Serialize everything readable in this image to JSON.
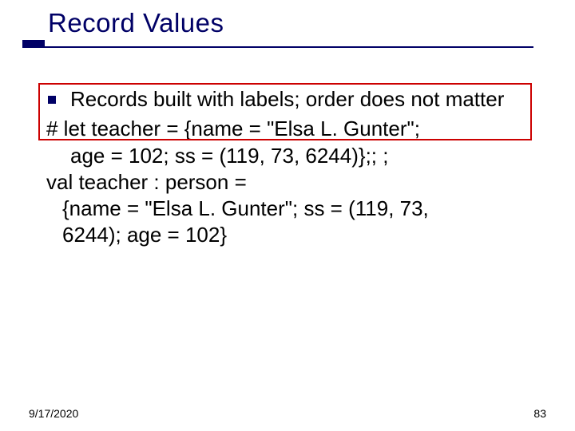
{
  "title": "Record Values",
  "bullet": "Records built with labels; order does not matter",
  "code": {
    "l1a": "# let teacher = {name = \"Elsa L. Gunter\";",
    "l1b": "age = 102; ss = (119, 73, 6244)};; ;",
    "l2a": "val teacher : person =",
    "l2b": "{name = \"Elsa L. Gunter\"; ss = (119, 73,",
    "l2c": "6244); age = 102}"
  },
  "footer": {
    "date": "9/17/2020",
    "page": "83"
  }
}
